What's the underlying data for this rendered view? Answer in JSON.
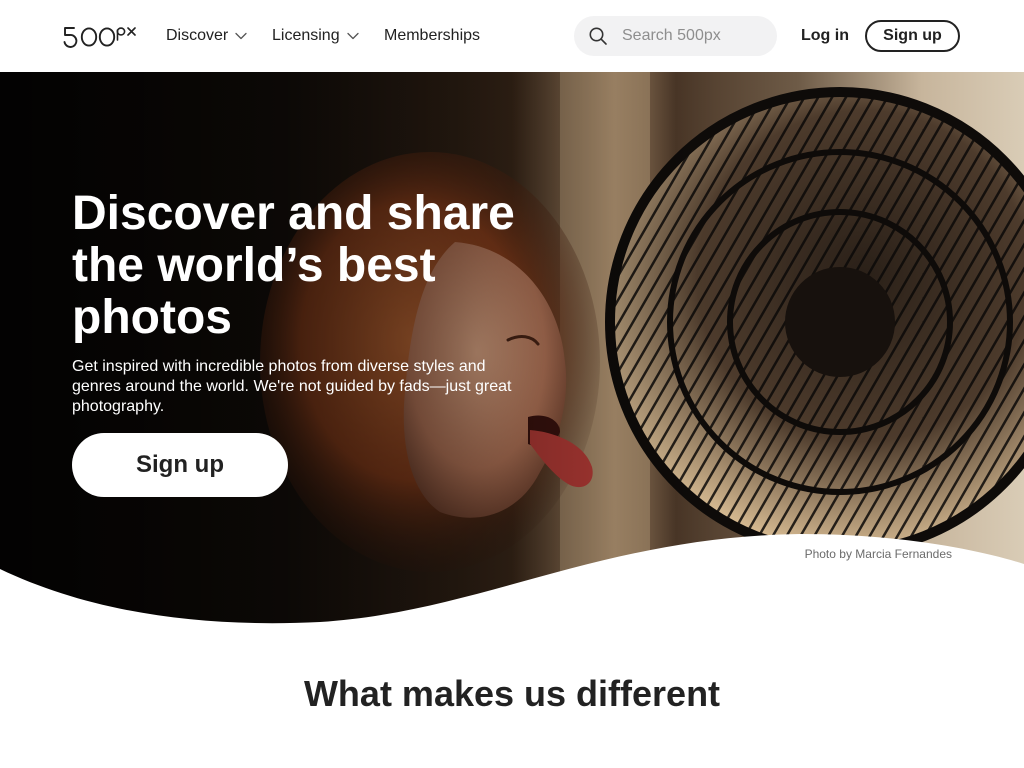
{
  "header": {
    "logo_text": "500px",
    "nav": [
      {
        "label": "Discover",
        "has_dropdown": true
      },
      {
        "label": "Licensing",
        "has_dropdown": true
      },
      {
        "label": "Memberships",
        "has_dropdown": false
      }
    ],
    "search": {
      "placeholder": "Search 500px",
      "value": ""
    },
    "login_label": "Log in",
    "signup_label": "Sign up"
  },
  "hero": {
    "title": "Discover and share the world’s best photos",
    "subtitle": "Get inspired with incredible photos from diverse styles and genres around the world. We're not guided by fads—just great photography.",
    "cta_label": "Sign up",
    "photo_credit": "Photo by Marcia Fernandes"
  },
  "section": {
    "title": "What makes us different"
  },
  "icons": {
    "search": "search-icon",
    "dropdown": "chevron-down-icon"
  },
  "colors": {
    "text": "#222222",
    "background": "#ffffff",
    "search_bg": "#f2f2f3",
    "placeholder": "#8e8e8e"
  }
}
